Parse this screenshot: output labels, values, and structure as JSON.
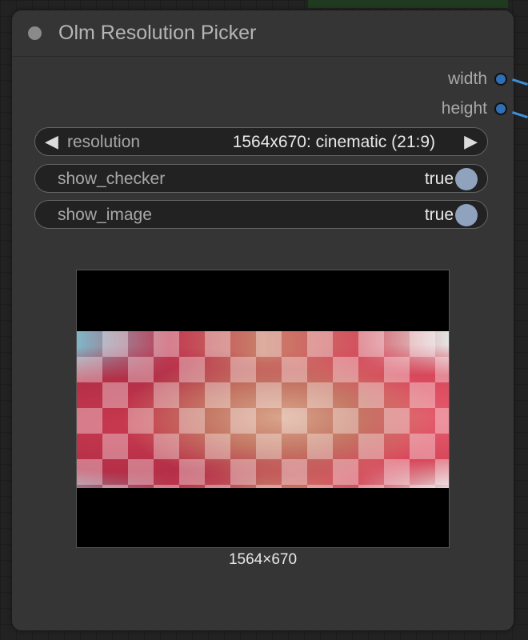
{
  "node": {
    "title": "Olm Resolution Picker",
    "outputs": [
      {
        "label": "width"
      },
      {
        "label": "height"
      }
    ],
    "resolution": {
      "name": "resolution",
      "value": "1564x670: cinematic (21:9)",
      "prev_glyph": "◀",
      "next_glyph": "▶"
    },
    "show_checker": {
      "name": "show_checker",
      "value": "true"
    },
    "show_image": {
      "name": "show_image",
      "value": "true"
    },
    "preview_caption": "1564×670"
  },
  "colors": {
    "node_bg": "#353535",
    "port": "#2e6fb5",
    "wire": "#3e8fd6",
    "toggle_knob": "#8fa3bf"
  },
  "icons": {
    "status": "circle-dot-icon",
    "output_port": "circle-port-icon",
    "prev": "left-triangle-icon",
    "next": "right-triangle-icon"
  }
}
